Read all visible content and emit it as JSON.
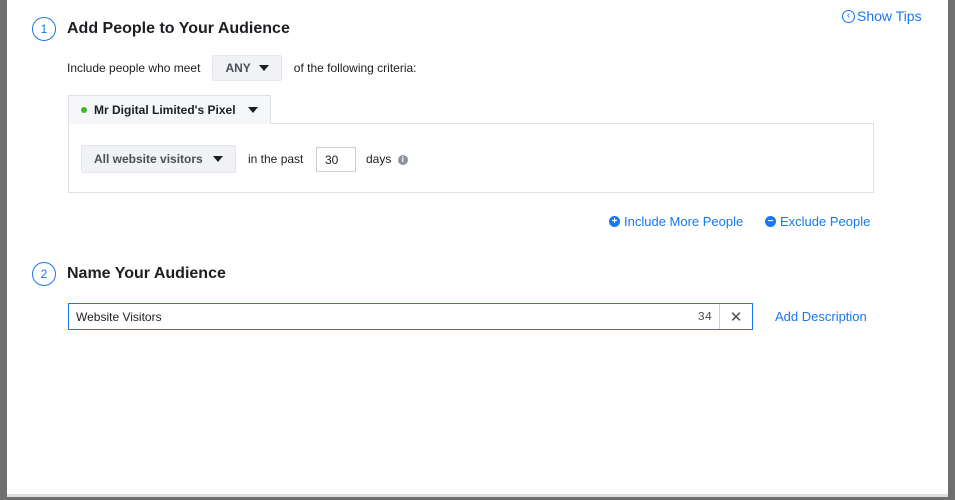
{
  "show_tips": {
    "label": "Show Tips",
    "icon": "chevron-left-circle-icon"
  },
  "step1": {
    "number": "1",
    "title": "Add People to Your Audience",
    "criteria_prefix": "Include people who meet",
    "match_value": "ANY",
    "criteria_suffix": "of the following criteria:",
    "pixel_label": "Mr Digital Limited's Pixel",
    "pixel_status_color": "#42b72a",
    "visitor_option": "All website visitors",
    "in_the_past": "in the past",
    "days_value": "30",
    "days_label": "days",
    "include_more": "Include More People",
    "exclude": "Exclude People"
  },
  "step2": {
    "number": "2",
    "title": "Name Your Audience",
    "name_value": "Website Visitors",
    "char_count": "34",
    "add_description": "Add Description"
  },
  "colors": {
    "accent": "#1877f2",
    "text": "#1c1e21",
    "border": "#dddfe2"
  }
}
